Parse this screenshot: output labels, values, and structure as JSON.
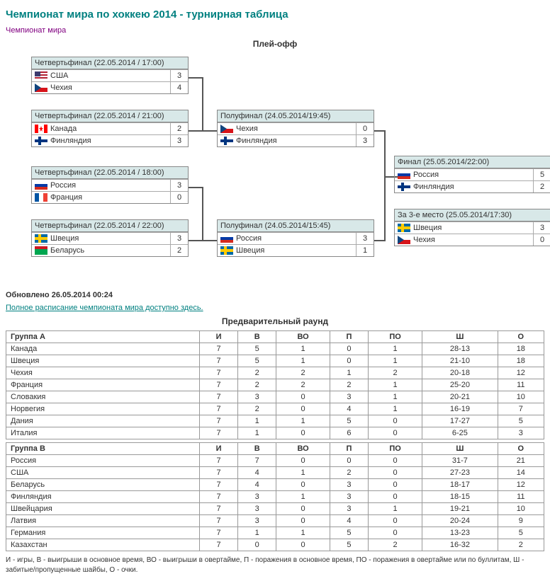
{
  "title": "Чемпионат мира по хоккею 2014 - турнирная таблица",
  "breadcrumb": "Чемпионат мира",
  "playoff_title": "Плей-офф",
  "prelim_title": "Предварительный раунд",
  "updated": "Обновлено 26.05.2014 00:24",
  "full_sched": "Полное расписание чемпионата мира доступно здесь.",
  "legend": "И - игры, В - выигрыши в основное время, ВО - выигрыши в овертайме, П - поражения в основное время, ПО - поражения в овертайме или по буллитам, Ш - забитые/пропущенные шайбы, О - очки.",
  "qf": [
    {
      "hdr": "Четвертьфинал (22.05.2014 / 17:00)",
      "t1": "США",
      "s1": "3",
      "t2": "Чехия",
      "s2": "4",
      "f1": "us",
      "f2": "cz"
    },
    {
      "hdr": "Четвертьфинал (22.05.2014 / 21:00)",
      "t1": "Канада",
      "s1": "2",
      "t2": "Финляндия",
      "s2": "3",
      "f1": "ca",
      "f2": "fi"
    },
    {
      "hdr": "Четвертьфинал (22.05.2014 / 18:00)",
      "t1": "Россия",
      "s1": "3",
      "t2": "Франция",
      "s2": "0",
      "f1": "ru",
      "f2": "fr"
    },
    {
      "hdr": "Четвертьфинал (22.05.2014 / 22:00)",
      "t1": "Швеция",
      "s1": "3",
      "t2": "Беларусь",
      "s2": "2",
      "f1": "se",
      "f2": "by"
    }
  ],
  "sf": [
    {
      "hdr": "Полуфинал (24.05.2014/19:45)",
      "t1": "Чехия",
      "s1": "0",
      "t2": "Финляндия",
      "s2": "3",
      "f1": "cz",
      "f2": "fi"
    },
    {
      "hdr": "Полуфинал (24.05.2014/15:45)",
      "t1": "Россия",
      "s1": "3",
      "t2": "Швеция",
      "s2": "1",
      "f1": "ru",
      "f2": "se"
    }
  ],
  "final": {
    "hdr": "Финал (25.05.2014/22:00)",
    "t1": "Россия",
    "s1": "5",
    "t2": "Финляндия",
    "s2": "2",
    "f1": "ru",
    "f2": "fi"
  },
  "third": {
    "hdr": "За 3-е место (25.05.2014/17:30)",
    "t1": "Швеция",
    "s1": "3",
    "t2": "Чехия",
    "s2": "0",
    "f1": "se",
    "f2": "cz"
  },
  "cols": [
    "И",
    "В",
    "ВО",
    "П",
    "ПО",
    "Ш",
    "О"
  ],
  "groupA": {
    "name": "Группа A",
    "rows": [
      [
        "Канада",
        "7",
        "5",
        "1",
        "0",
        "1",
        "28-13",
        "18"
      ],
      [
        "Швеция",
        "7",
        "5",
        "1",
        "0",
        "1",
        "21-10",
        "18"
      ],
      [
        "Чехия",
        "7",
        "2",
        "2",
        "1",
        "2",
        "20-18",
        "12"
      ],
      [
        "Франция",
        "7",
        "2",
        "2",
        "2",
        "1",
        "25-20",
        "11"
      ],
      [
        "Словакия",
        "7",
        "3",
        "0",
        "3",
        "1",
        "20-21",
        "10"
      ],
      [
        "Норвегия",
        "7",
        "2",
        "0",
        "4",
        "1",
        "16-19",
        "7"
      ],
      [
        "Дания",
        "7",
        "1",
        "1",
        "5",
        "0",
        "17-27",
        "5"
      ],
      [
        "Италия",
        "7",
        "1",
        "0",
        "6",
        "0",
        "6-25",
        "3"
      ]
    ]
  },
  "groupB": {
    "name": "Группа B",
    "rows": [
      [
        "Россия",
        "7",
        "7",
        "0",
        "0",
        "0",
        "31-7",
        "21"
      ],
      [
        "США",
        "7",
        "4",
        "1",
        "2",
        "0",
        "27-23",
        "14"
      ],
      [
        "Беларусь",
        "7",
        "4",
        "0",
        "3",
        "0",
        "18-17",
        "12"
      ],
      [
        "Финляндия",
        "7",
        "3",
        "1",
        "3",
        "0",
        "18-15",
        "11"
      ],
      [
        "Швейцария",
        "7",
        "3",
        "0",
        "3",
        "1",
        "19-21",
        "10"
      ],
      [
        "Латвия",
        "7",
        "3",
        "0",
        "4",
        "0",
        "20-24",
        "9"
      ],
      [
        "Германия",
        "7",
        "1",
        "1",
        "5",
        "0",
        "13-23",
        "5"
      ],
      [
        "Казахстан",
        "7",
        "0",
        "0",
        "5",
        "2",
        "16-32",
        "2"
      ]
    ]
  }
}
